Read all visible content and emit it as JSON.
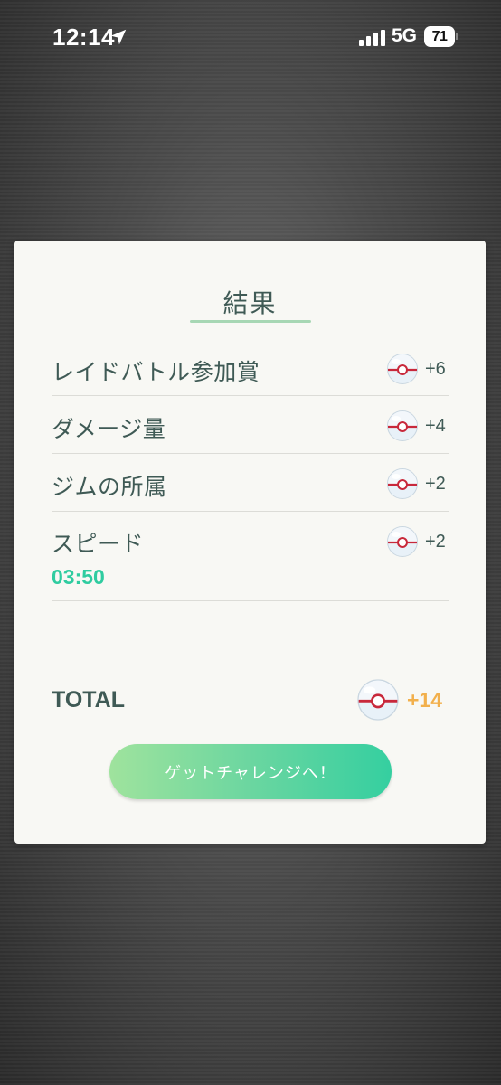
{
  "status_bar": {
    "time": "12:14",
    "network": "5G",
    "battery": "71",
    "icons": [
      "location-arrow-icon",
      "signal-bars-icon",
      "battery-icon"
    ]
  },
  "result": {
    "title": "結果",
    "rows": [
      {
        "label": "レイドバトル参加賞",
        "value": "+6",
        "icon": "premier-ball-icon"
      },
      {
        "label": "ダメージ量",
        "value": "+4",
        "icon": "premier-ball-icon"
      },
      {
        "label": "ジムの所属",
        "value": "+2",
        "icon": "premier-ball-icon"
      },
      {
        "label": "スピード",
        "value": "+2",
        "time": "03:50",
        "icon": "premier-ball-icon"
      }
    ],
    "total_label": "TOTAL",
    "total_value": "+14",
    "button_label": "ゲットチャレンジへ！"
  },
  "colors": {
    "accent_green": "#35cfa0",
    "total_orange": "#f2b04c",
    "text_dark": "#3f5a55",
    "card_bg": "#f8f8f4"
  }
}
